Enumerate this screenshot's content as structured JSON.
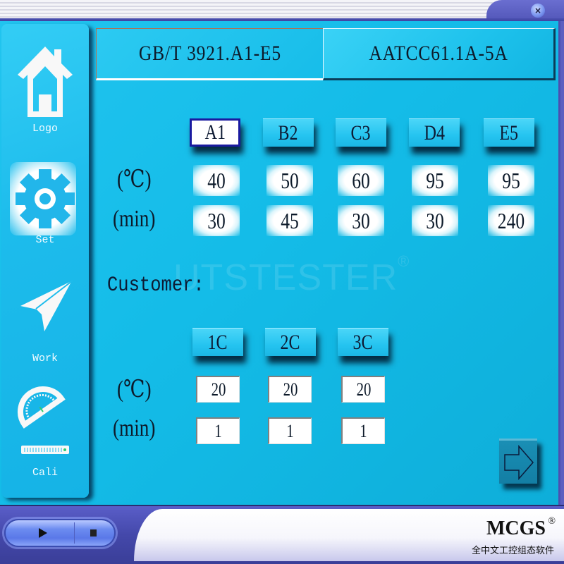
{
  "window": {
    "close_icon": "×"
  },
  "sidebar": {
    "items": [
      {
        "label": "Logo",
        "icon": "home-icon"
      },
      {
        "label": "Set",
        "icon": "gear-icon",
        "active": true
      },
      {
        "label": "Work",
        "icon": "paper-plane-icon"
      },
      {
        "label": "Cali",
        "icon": "protractor-ruler-icon"
      }
    ]
  },
  "standard_tabs": [
    {
      "label": "GB/T 3921.A1-E5",
      "active": true
    },
    {
      "label": "AATCC61.1A-5A",
      "active": false
    }
  ],
  "standard_modes": {
    "row_labels": {
      "temp": "(℃)",
      "time": "(min)"
    },
    "columns": [
      {
        "label": "A1",
        "temp": "40",
        "time": "30",
        "selected": true
      },
      {
        "label": "B2",
        "temp": "50",
        "time": "45"
      },
      {
        "label": "C3",
        "temp": "60",
        "time": "30"
      },
      {
        "label": "D4",
        "temp": "95",
        "time": "30"
      },
      {
        "label": "E5",
        "temp": "95",
        "time": "240"
      }
    ]
  },
  "customer": {
    "label": "Customer:",
    "row_labels": {
      "temp": "(℃)",
      "time": "(min)"
    },
    "columns": [
      {
        "label": "1C",
        "temp": "20",
        "time": "1"
      },
      {
        "label": "2C",
        "temp": "20",
        "time": "1"
      },
      {
        "label": "3C",
        "temp": "20",
        "time": "1"
      }
    ]
  },
  "watermark": {
    "text": "UTSTESTER",
    "mark": "®"
  },
  "next_button": {
    "icon": "arrow-right-icon"
  },
  "bottom": {
    "play_icon": "play-icon",
    "stop_icon": "stop-icon",
    "brand": "MCGS",
    "brand_mark": "®",
    "brand_subtitle": "全中文工控组态软件"
  },
  "colors": {
    "main_bg": "#14bce8",
    "frame": "#4c50b0",
    "selected_border": "#1a1aa0",
    "next_button": "#137ea4"
  }
}
